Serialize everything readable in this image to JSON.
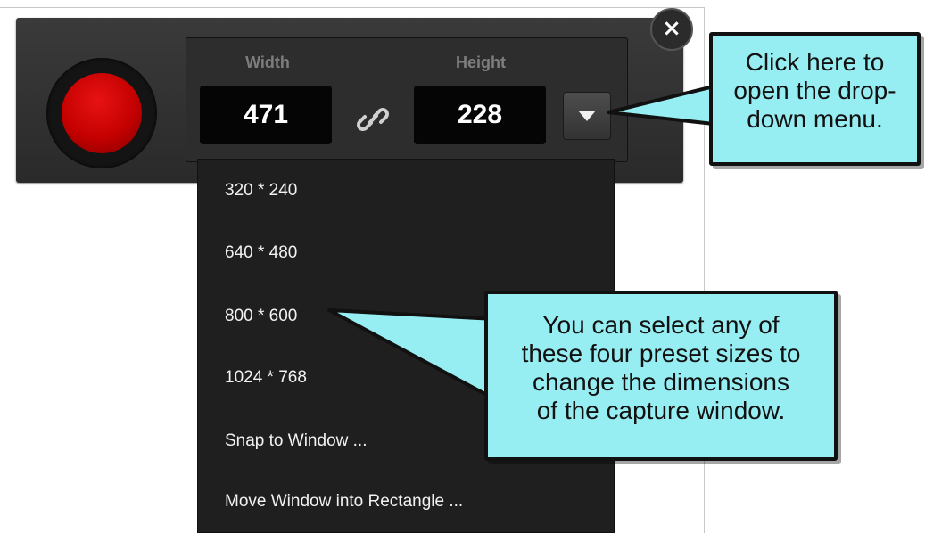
{
  "toolbar": {
    "close_label": "×",
    "width_label": "Width",
    "height_label": "Height",
    "width_value": "471",
    "height_value": "228",
    "icons": {
      "record": "record-icon",
      "link": "link-icon",
      "dropdown": "chevron-down-icon",
      "close": "close-icon"
    }
  },
  "menu": {
    "items": [
      "320 * 240",
      "640 * 480",
      "800 * 600",
      "1024 * 768",
      "Snap to Window ...",
      "Move Window into Rectangle ..."
    ]
  },
  "callouts": {
    "dropdown_hint": [
      "Click here to",
      "open the drop-",
      "down menu."
    ],
    "preset_hint": [
      "You can select any of",
      "these four preset sizes to",
      "change the dimensions",
      "of the capture window."
    ]
  },
  "colors": {
    "record_red": "#d40000",
    "callout_fill": "#97eef2",
    "toolbar_bg": "#2d2d2d"
  }
}
